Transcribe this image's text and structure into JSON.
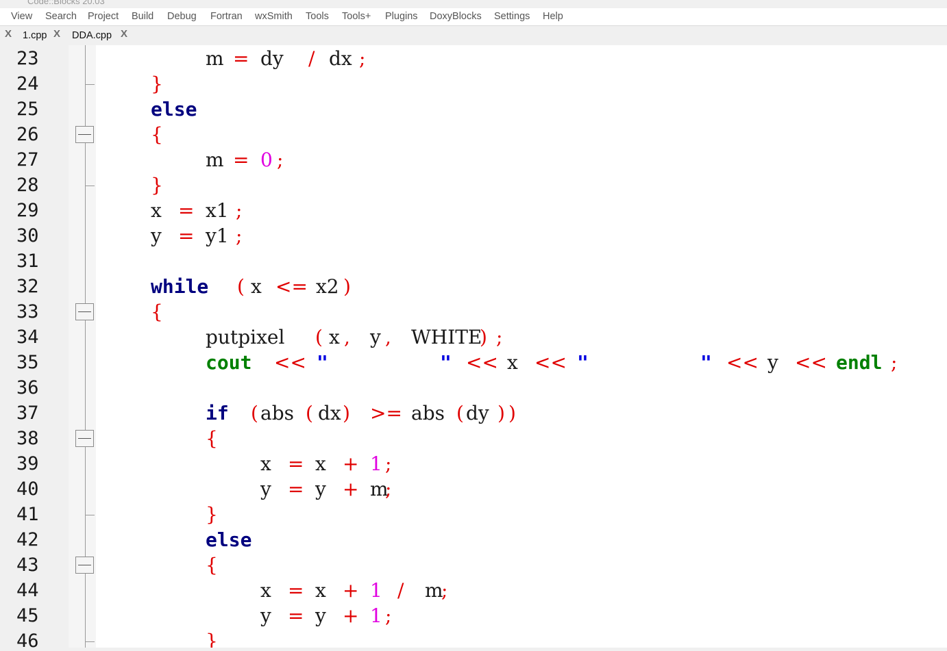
{
  "window": {
    "title": "Code::Blocks 20.03"
  },
  "menu": [
    "View",
    "Search",
    "Project",
    "Build",
    "Debug",
    "Fortran",
    "wxSmith",
    "Tools",
    "Tools+",
    "Plugins",
    "DoxyBlocks",
    "Settings",
    "Help"
  ],
  "tabs": [
    {
      "label": "1.cpp",
      "close": "X"
    },
    {
      "label": "DDA.cpp",
      "close": "X"
    }
  ],
  "editor": {
    "lines": [
      {
        "n": "23",
        "tokens": [
          {
            "t": "m",
            "c": "id"
          },
          {
            "t": "=",
            "c": "op"
          },
          {
            "t": "dy",
            "c": "id"
          },
          {
            "t": "/",
            "c": "op"
          },
          {
            "t": "dx",
            "c": "id"
          },
          {
            "t": ";",
            "c": "op"
          }
        ]
      },
      {
        "n": "24",
        "tokens": [
          {
            "t": "}",
            "c": "op"
          }
        ]
      },
      {
        "n": "25",
        "tokens": [
          {
            "t": "else",
            "c": "kw"
          }
        ]
      },
      {
        "n": "26",
        "tokens": [
          {
            "t": "{",
            "c": "op"
          }
        ]
      },
      {
        "n": "27",
        "tokens": [
          {
            "t": "m",
            "c": "id"
          },
          {
            "t": "=",
            "c": "op"
          },
          {
            "t": "0",
            "c": "num"
          },
          {
            "t": ";",
            "c": "op"
          }
        ]
      },
      {
        "n": "28",
        "tokens": [
          {
            "t": "}",
            "c": "op"
          }
        ]
      },
      {
        "n": "29",
        "tokens": [
          {
            "t": "x",
            "c": "id"
          },
          {
            "t": "=",
            "c": "op"
          },
          {
            "t": "x1",
            "c": "id"
          },
          {
            "t": ";",
            "c": "op"
          }
        ]
      },
      {
        "n": "30",
        "tokens": [
          {
            "t": "y",
            "c": "id"
          },
          {
            "t": "=",
            "c": "op"
          },
          {
            "t": "y1",
            "c": "id"
          },
          {
            "t": ";",
            "c": "op"
          }
        ]
      },
      {
        "n": "31",
        "tokens": []
      },
      {
        "n": "32",
        "tokens": [
          {
            "t": "while",
            "c": "kw"
          },
          {
            "t": "(",
            "c": "op"
          },
          {
            "t": "x",
            "c": "id"
          },
          {
            "t": "<=",
            "c": "op"
          },
          {
            "t": "x2",
            "c": "id"
          },
          {
            "t": ")",
            "c": "op"
          }
        ]
      },
      {
        "n": "33",
        "tokens": [
          {
            "t": "{",
            "c": "op"
          }
        ]
      },
      {
        "n": "34",
        "tokens": [
          {
            "t": "putpixel",
            "c": "id"
          },
          {
            "t": "(",
            "c": "op"
          },
          {
            "t": "x",
            "c": "id"
          },
          {
            "t": ",",
            "c": "op"
          },
          {
            "t": "y",
            "c": "id"
          },
          {
            "t": ",",
            "c": "op"
          },
          {
            "t": "WHITE",
            "c": "id"
          },
          {
            "t": ")",
            "c": "op"
          },
          {
            "t": ";",
            "c": "op"
          }
        ]
      },
      {
        "n": "35",
        "tokens": [
          {
            "t": "cout",
            "c": "grn"
          },
          {
            "t": "<<",
            "c": "op"
          },
          {
            "t": "\"",
            "c": "str"
          },
          {
            "t": "\"",
            "c": "str"
          },
          {
            "t": "<<",
            "c": "op"
          },
          {
            "t": "x",
            "c": "id"
          },
          {
            "t": "<<",
            "c": "op"
          },
          {
            "t": "\"",
            "c": "str"
          },
          {
            "t": "\"",
            "c": "str"
          },
          {
            "t": "<<",
            "c": "op"
          },
          {
            "t": "y",
            "c": "id"
          },
          {
            "t": "<<",
            "c": "op"
          },
          {
            "t": "endl",
            "c": "grn"
          },
          {
            "t": ";",
            "c": "op"
          }
        ]
      },
      {
        "n": "36",
        "tokens": []
      },
      {
        "n": "37",
        "tokens": [
          {
            "t": "if",
            "c": "kw"
          },
          {
            "t": "(",
            "c": "op"
          },
          {
            "t": "abs",
            "c": "id"
          },
          {
            "t": "(",
            "c": "op"
          },
          {
            "t": "dx",
            "c": "id"
          },
          {
            "t": ")",
            "c": "op"
          },
          {
            "t": ">=",
            "c": "op"
          },
          {
            "t": "abs",
            "c": "id"
          },
          {
            "t": "(",
            "c": "op"
          },
          {
            "t": "dy",
            "c": "id"
          },
          {
            "t": ")",
            "c": "op"
          },
          {
            "t": ")",
            "c": "op"
          }
        ]
      },
      {
        "n": "38",
        "tokens": [
          {
            "t": "{",
            "c": "op"
          }
        ]
      },
      {
        "n": "39",
        "tokens": [
          {
            "t": "x",
            "c": "id"
          },
          {
            "t": "=",
            "c": "op"
          },
          {
            "t": "x",
            "c": "id"
          },
          {
            "t": "+",
            "c": "op"
          },
          {
            "t": "1",
            "c": "num"
          },
          {
            "t": ";",
            "c": "op"
          }
        ]
      },
      {
        "n": "40",
        "tokens": [
          {
            "t": "y",
            "c": "id"
          },
          {
            "t": "=",
            "c": "op"
          },
          {
            "t": "y",
            "c": "id"
          },
          {
            "t": "+",
            "c": "op"
          },
          {
            "t": "m",
            "c": "id"
          },
          {
            "t": ";",
            "c": "op"
          }
        ]
      },
      {
        "n": "41",
        "tokens": [
          {
            "t": "}",
            "c": "op"
          }
        ]
      },
      {
        "n": "42",
        "tokens": [
          {
            "t": "else",
            "c": "kw"
          }
        ]
      },
      {
        "n": "43",
        "tokens": [
          {
            "t": "{",
            "c": "op"
          }
        ]
      },
      {
        "n": "44",
        "tokens": [
          {
            "t": "x",
            "c": "id"
          },
          {
            "t": "=",
            "c": "op"
          },
          {
            "t": "x",
            "c": "id"
          },
          {
            "t": "+",
            "c": "op"
          },
          {
            "t": "1",
            "c": "num"
          },
          {
            "t": "/",
            "c": "op"
          },
          {
            "t": "m",
            "c": "id"
          },
          {
            "t": ";",
            "c": "op"
          }
        ]
      },
      {
        "n": "45",
        "tokens": [
          {
            "t": "y",
            "c": "id"
          },
          {
            "t": "=",
            "c": "op"
          },
          {
            "t": "y",
            "c": "id"
          },
          {
            "t": "+",
            "c": "op"
          },
          {
            "t": "1",
            "c": "num"
          },
          {
            "t": ";",
            "c": "op"
          }
        ]
      },
      {
        "n": "46",
        "tokens": [
          {
            "t": "}",
            "c": "op"
          }
        ]
      }
    ]
  },
  "colors": {
    "keyword": "#00007f",
    "stream": "#008000",
    "operator": "#e00000",
    "number": "#e000e0",
    "string": "#0000e0",
    "identifier": "#1a1a1a"
  }
}
